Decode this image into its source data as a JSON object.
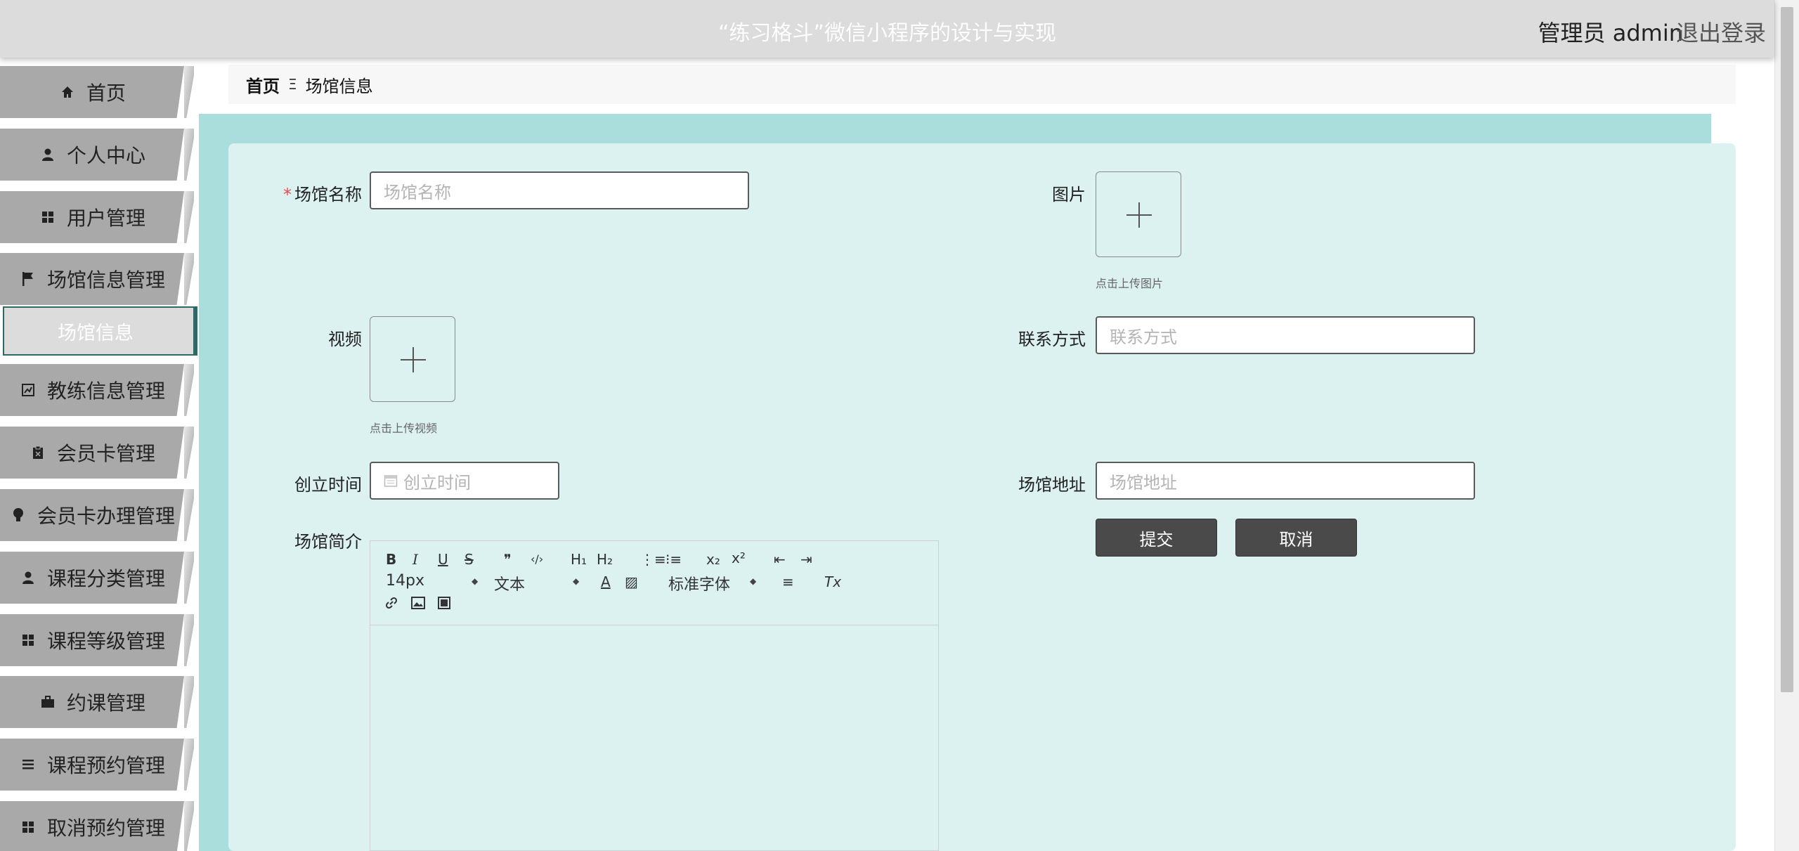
{
  "header": {
    "title": "“练习格斗”微信小程序的设计与实现",
    "user": "管理员 admin",
    "logout": "退出登录"
  },
  "sidebar": {
    "items": [
      {
        "label": "首页",
        "icon": "home-icon"
      },
      {
        "label": "个人中心",
        "icon": "user-icon"
      },
      {
        "label": "用户管理",
        "icon": "grid-icon"
      },
      {
        "label": "场馆信息管理",
        "icon": "flag-icon"
      },
      {
        "label": "教练信息管理",
        "icon": "chart-icon"
      },
      {
        "label": "会员卡管理",
        "icon": "clipboard-icon"
      },
      {
        "label": "会员卡办理管理",
        "icon": "bulb-icon"
      },
      {
        "label": "课程分类管理",
        "icon": "user-icon"
      },
      {
        "label": "课程等级管理",
        "icon": "grid-icon"
      },
      {
        "label": "约课管理",
        "icon": "briefcase-icon"
      },
      {
        "label": "课程预约管理",
        "icon": "list-icon"
      },
      {
        "label": "取消预约管理",
        "icon": "grid-icon"
      }
    ],
    "active_sub": "场馆信息"
  },
  "breadcrumb": {
    "home": "首页",
    "separator": "Ξ",
    "current": "场馆信息"
  },
  "form": {
    "name": {
      "label": "场馆名称",
      "placeholder": "场馆名称",
      "required": "*"
    },
    "image": {
      "label": "图片",
      "hint": "点击上传图片"
    },
    "video": {
      "label": "视频",
      "hint": "点击上传视频"
    },
    "contact": {
      "label": "联系方式",
      "placeholder": "联系方式"
    },
    "created": {
      "label": "创立时间",
      "placeholder": "创立时间"
    },
    "address": {
      "label": "场馆地址",
      "placeholder": "场馆地址"
    },
    "intro": {
      "label": "场馆简介"
    },
    "submit": "提交",
    "cancel": "取消"
  },
  "editor": {
    "font_size": "14px",
    "header_select": "文本",
    "font_family": "标准字体",
    "buttons": {
      "bold": "B",
      "italic": "I",
      "underline": "U",
      "strike": "S",
      "quote": "❞",
      "code": "‹/›",
      "h1": "H₁",
      "h2": "H₂",
      "ol": "⋮≡",
      "ul": "⁝≡",
      "sub": "x₂",
      "sup": "x²",
      "outdent": "⇤",
      "indent": "⇥",
      "color": "A",
      "bg": "▨",
      "align": "≡",
      "clean": "Tx",
      "link": "🔗",
      "img": "▣",
      "video": "▤"
    }
  }
}
